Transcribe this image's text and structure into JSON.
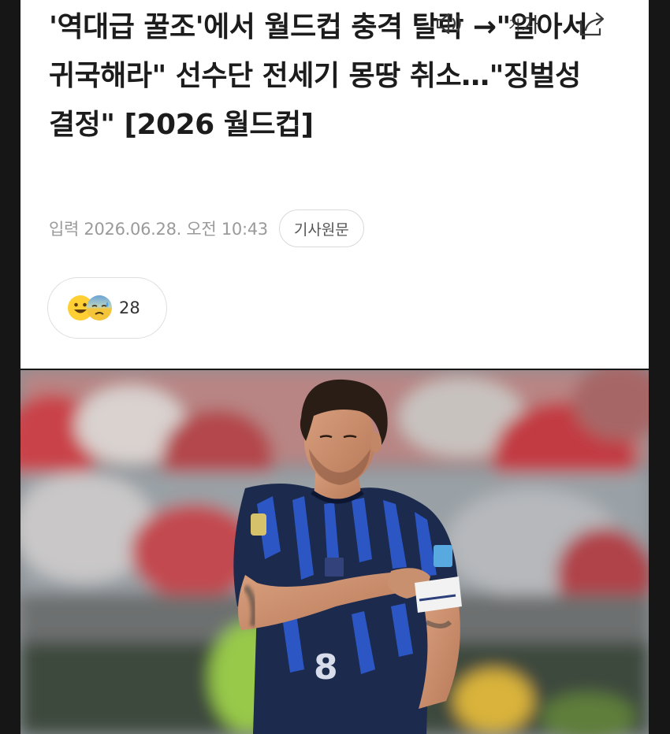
{
  "article": {
    "headline": "'역대급 꿀조'에서 월드컵 충격 탈락 →\"알아서 귀국해라\" 선수단 전세기 몽땅 취소…\"징벌성 결정\" [2026 월드컵]",
    "input_date": "입력 2026.06.28. 오전 10:43",
    "original_button": "기사원문"
  },
  "reactions": {
    "count": "28",
    "icons": [
      "smiling-face-icon",
      "sad-sweat-face-icon"
    ]
  },
  "toolbar": {
    "audio_icon": "speaker-icon",
    "font_small": "가",
    "font_large": "가",
    "share_icon": "share-icon"
  },
  "photo": {
    "jersey_number": "8",
    "colors": {
      "jersey": "#1a2a4a",
      "jersey_accent": "#2a57c9",
      "captain_band": "#f2f2f2"
    }
  }
}
